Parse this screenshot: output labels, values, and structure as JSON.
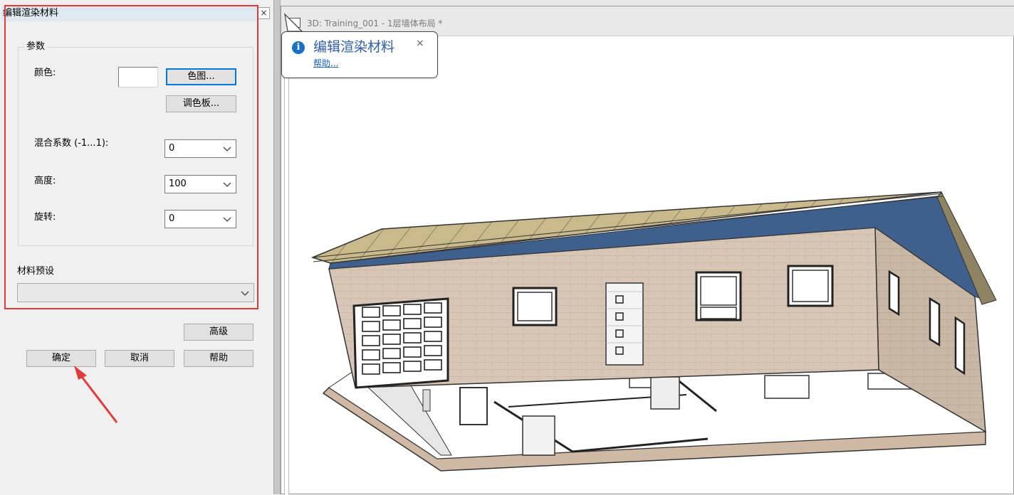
{
  "dialog": {
    "title": "编辑渲染材料",
    "close_glyph": "×",
    "params_group": "参数",
    "color_label": "颜色:",
    "color_map_button": "色图...",
    "palette_button": "调色板...",
    "blend_label": "混合系数 (-1...1):",
    "blend_value": "0",
    "height_label": "高度:",
    "height_value": "100",
    "rotate_label": "旋转:",
    "rotate_value": "0",
    "preset_label": "材料预设",
    "preset_value": "",
    "advanced_button": "高级",
    "ok_button": "确定",
    "cancel_button": "取消",
    "help_button": "帮助"
  },
  "view": {
    "tab_title": "3D: Training_001 - 1层墙体布局 *"
  },
  "tooltip": {
    "title": "编辑渲染材料",
    "close_glyph": "×",
    "link": "帮助..."
  },
  "colors": {
    "highlight_border": "#e03a3a",
    "annotation_arrow": "#e23b3b",
    "focus_blue": "#0078d7",
    "wall_brick": "#d8c7b6",
    "roof_tan": "#c8b98a",
    "roof_blue": "#3f5f8c"
  }
}
